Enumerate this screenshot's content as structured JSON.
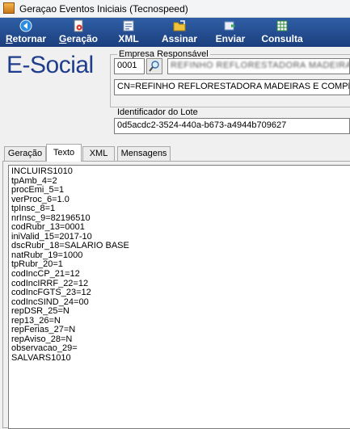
{
  "window": {
    "title": "Geraçao Eventos Iniciais (Tecnospeed)"
  },
  "toolbar": {
    "buttons": [
      {
        "pre": "",
        "hot": "R",
        "post": "etornar",
        "icon": "back-arrow-icon"
      },
      {
        "pre": "",
        "hot": "G",
        "post": "eração",
        "icon": "document-gear-icon"
      },
      {
        "pre": "",
        "hot": "",
        "post": "XML",
        "icon": "xml-file-icon"
      },
      {
        "pre": "",
        "hot": "",
        "post": "Assinar",
        "icon": "folder-sign-icon"
      },
      {
        "pre": "",
        "hot": "",
        "post": "Enviar",
        "icon": "send-icon"
      },
      {
        "pre": "",
        "hot": "",
        "post": "Consulta",
        "icon": "grid-search-icon"
      }
    ]
  },
  "logo": {
    "text": "E-Social"
  },
  "empresa": {
    "legend": "Empresa Responsável",
    "code": "0001",
    "name": "REFINHO REFLORESTADORA MADEIRAS E",
    "cn": "CN=REFINHO REFLORESTADORA MADEIRAS E COMPEN"
  },
  "lote": {
    "label": "Identificador do Lote",
    "value": "0d5acdc2-3524-440a-b673-a4944b709627"
  },
  "tabs": [
    {
      "label": "Geração"
    },
    {
      "label": "Texto"
    },
    {
      "label": "XML"
    },
    {
      "label": "Mensagens"
    }
  ],
  "memo": {
    "lines": [
      "INCLUIRS1010",
      "tpAmb_4=2",
      "procEmi_5=1",
      "verProc_6=1.0",
      "tpInsc_8=1",
      "nrInsc_9=82196510",
      "codRubr_13=0001",
      "iniValid_15=2017-10",
      "dscRubr_18=SALARIO BASE",
      "natRubr_19=1000",
      "tpRubr_20=1",
      "codIncCP_21=12",
      "codIncIRRF_22=12",
      "codIncFGTS_23=12",
      "codIncSIND_24=00",
      "repDSR_25=N",
      "rep13_26=N",
      "repFerias_27=N",
      "repAviso_28=N",
      "observacao_29=",
      "SALVARS1010"
    ]
  }
}
